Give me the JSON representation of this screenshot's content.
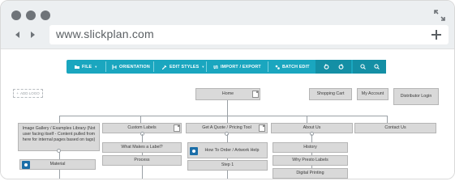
{
  "browser": {
    "url": "www.slickplan.com"
  },
  "toolbar": {
    "file": "FILE",
    "orientation": "ORIENTATION",
    "edit_styles": "EDIT STYLES",
    "import_export": "IMPORT / EXPORT",
    "batch_edit": "BATCH EDIT",
    "accent_color": "#1aa6bf"
  },
  "canvas": {
    "add_logo": "ADD LOGO"
  },
  "sitemap": {
    "home": "Home",
    "shopping_cart": "Shopping Cart",
    "my_account": "My Account",
    "distributor_login": "Distributor Login",
    "gallery": "Image Gallery / Examples Library (Not user facing itself - Content pulled from here for internal pages based on tags)",
    "custom_labels": "Custom Labels",
    "get_a_quote": "Get A Quote / Pricing Tool",
    "about_us": "About Us",
    "contact_us": "Contact Us",
    "material": "Material",
    "what_makes_a_label": "What Makes a Label?",
    "process": "Process",
    "how_to_order": "How To Order / Artwork Help",
    "step_1": "Step 1",
    "history": "History",
    "why_presto_labels": "Why Presto Labels",
    "digital_printing": "Digital Printing"
  }
}
